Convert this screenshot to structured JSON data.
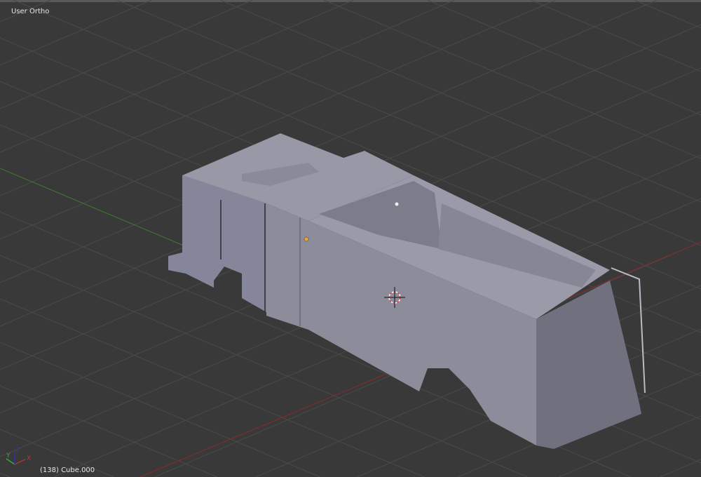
{
  "viewport": {
    "view_label": "User Ortho",
    "object_label": "(138) Cube.000",
    "axis_labels": {
      "x": "X",
      "y": "Y",
      "z": "Z"
    }
  },
  "colors": {
    "background": "#393939",
    "grid": "#4a4a4a",
    "x_axis": "#8a2a2a",
    "y_axis": "#3a7a2a",
    "mesh_side": "#8c8c9b",
    "mesh_top": "#9898a6",
    "mesh_front": "#6f6f7f"
  }
}
